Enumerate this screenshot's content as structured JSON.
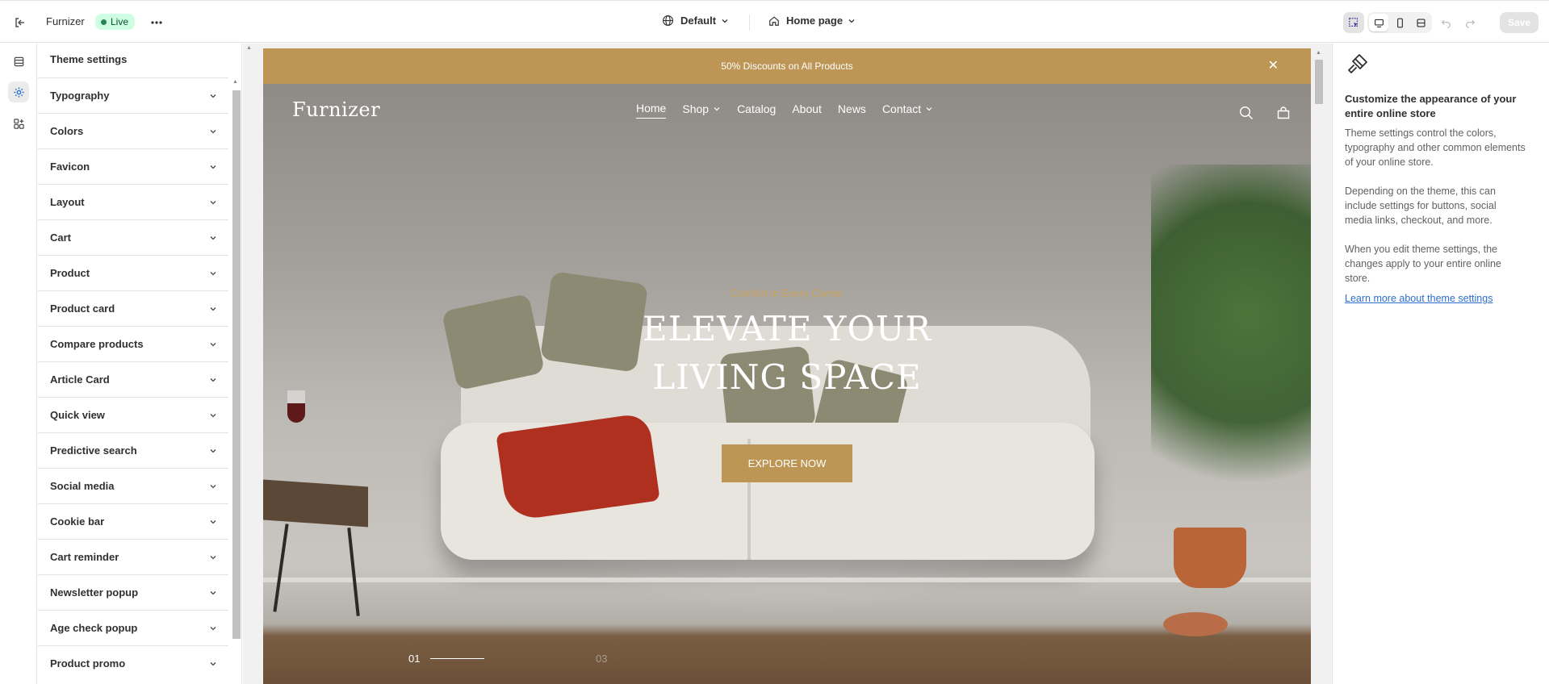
{
  "topbar": {
    "store_name": "Furnizer",
    "status": "Live",
    "theme_selector": "Default",
    "page_selector": "Home page",
    "save_label": "Save"
  },
  "rail": {
    "items": [
      "sections-icon",
      "theme-settings-icon",
      "app-embeds-icon"
    ],
    "active": "theme-settings-icon"
  },
  "panel": {
    "title": "Theme settings",
    "items": [
      {
        "label": "Typography"
      },
      {
        "label": "Colors"
      },
      {
        "label": "Favicon"
      },
      {
        "label": "Layout"
      },
      {
        "label": "Cart"
      },
      {
        "label": "Product"
      },
      {
        "label": "Product card"
      },
      {
        "label": "Compare products"
      },
      {
        "label": "Article Card"
      },
      {
        "label": "Quick view"
      },
      {
        "label": "Predictive search"
      },
      {
        "label": "Social media"
      },
      {
        "label": "Cookie bar"
      },
      {
        "label": "Cart reminder"
      },
      {
        "label": "Newsletter popup"
      },
      {
        "label": "Age check popup"
      },
      {
        "label": "Product promo"
      }
    ]
  },
  "preview": {
    "announcement": "50% Discounts on All Products",
    "logo": "Furnizer",
    "nav": [
      {
        "label": "Home"
      },
      {
        "label": "Shop"
      },
      {
        "label": "Catalog"
      },
      {
        "label": "About"
      },
      {
        "label": "News"
      },
      {
        "label": "Contact"
      }
    ],
    "hero_subtitle": "Comfort in Every Corner",
    "hero_title_line1": "ELEVATE YOUR",
    "hero_title_line2": "LIVING SPACE",
    "hero_button": "EXPLORE NOW",
    "slide_current": "01",
    "slide_total": "03"
  },
  "info": {
    "title": "Customize the appearance of your entire online store",
    "paragraph1": "Theme settings control the colors, typography and other common elements of your online store.",
    "paragraph2": "Depending on the theme, this can include settings for buttons, social media links, checkout, and more.",
    "paragraph3": "When you edit theme settings, the changes apply to your entire online store.",
    "link": "Learn more about theme settings"
  },
  "colors": {
    "accent_gold": "#bd9656",
    "live_badge_bg": "#cdfee1",
    "link_blue": "#2c6ecb"
  }
}
